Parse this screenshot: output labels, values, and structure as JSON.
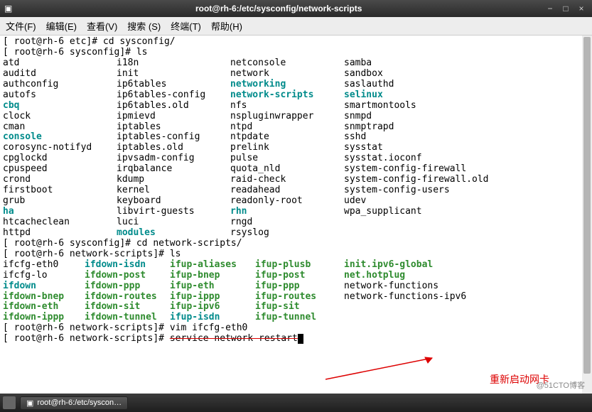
{
  "titlebar": {
    "title": "root@rh-6:/etc/sysconfig/network-scripts"
  },
  "menubar": {
    "items": [
      {
        "label": "文件(F)"
      },
      {
        "label": "编辑(E)"
      },
      {
        "label": "查看(V)"
      },
      {
        "label": "搜索 (S)"
      },
      {
        "label": "终端(T)"
      },
      {
        "label": "帮助(H)"
      }
    ]
  },
  "terminal": {
    "line1_prompt_open": "[ root@rh-6 etc]# ",
    "line1_cmd": "cd sysconfig/",
    "line2_prompt_open": "[ root@rh-6 sysconfig]# ",
    "line2_cmd": "ls",
    "ls1": [
      {
        "c1": {
          "t": "atd"
        },
        "c2": {
          "t": "i18n"
        },
        "c3": {
          "t": "netconsole"
        },
        "c4": {
          "t": "samba"
        }
      },
      {
        "c1": {
          "t": "auditd"
        },
        "c2": {
          "t": "init"
        },
        "c3": {
          "t": "network"
        },
        "c4": {
          "t": "sandbox"
        }
      },
      {
        "c1": {
          "t": "authconfig"
        },
        "c2": {
          "t": "ip6tables"
        },
        "c3": {
          "t": "networking",
          "cls": "cyan"
        },
        "c4": {
          "t": "saslauthd"
        }
      },
      {
        "c1": {
          "t": "autofs"
        },
        "c2": {
          "t": "ip6tables-config"
        },
        "c3": {
          "t": "network-scripts",
          "cls": "cyan"
        },
        "c4": {
          "t": "selinux",
          "cls": "cyan"
        }
      },
      {
        "c1": {
          "t": "cbq",
          "cls": "cyan"
        },
        "c2": {
          "t": "ip6tables.old"
        },
        "c3": {
          "t": "nfs"
        },
        "c4": {
          "t": "smartmontools"
        }
      },
      {
        "c1": {
          "t": "clock"
        },
        "c2": {
          "t": "ipmievd"
        },
        "c3": {
          "t": "nspluginwrapper"
        },
        "c4": {
          "t": "snmpd"
        }
      },
      {
        "c1": {
          "t": "cman"
        },
        "c2": {
          "t": "iptables"
        },
        "c3": {
          "t": "ntpd"
        },
        "c4": {
          "t": "snmptrapd"
        }
      },
      {
        "c1": {
          "t": "console",
          "cls": "cyan"
        },
        "c2": {
          "t": "iptables-config"
        },
        "c3": {
          "t": "ntpdate"
        },
        "c4": {
          "t": "sshd"
        }
      },
      {
        "c1": {
          "t": "corosync-notifyd"
        },
        "c2": {
          "t": "iptables.old"
        },
        "c3": {
          "t": "prelink"
        },
        "c4": {
          "t": "sysstat"
        }
      },
      {
        "c1": {
          "t": "cpglockd"
        },
        "c2": {
          "t": "ipvsadm-config"
        },
        "c3": {
          "t": "pulse"
        },
        "c4": {
          "t": "sysstat.ioconf"
        }
      },
      {
        "c1": {
          "t": "cpuspeed"
        },
        "c2": {
          "t": "irqbalance"
        },
        "c3": {
          "t": "quota_nld"
        },
        "c4": {
          "t": "system-config-firewall"
        }
      },
      {
        "c1": {
          "t": "crond"
        },
        "c2": {
          "t": "kdump"
        },
        "c3": {
          "t": "raid-check"
        },
        "c4": {
          "t": "system-config-firewall.old"
        }
      },
      {
        "c1": {
          "t": "firstboot"
        },
        "c2": {
          "t": "kernel"
        },
        "c3": {
          "t": "readahead"
        },
        "c4": {
          "t": "system-config-users"
        }
      },
      {
        "c1": {
          "t": "grub"
        },
        "c2": {
          "t": "keyboard"
        },
        "c3": {
          "t": "readonly-root"
        },
        "c4": {
          "t": "udev"
        }
      },
      {
        "c1": {
          "t": "ha",
          "cls": "cyan"
        },
        "c2": {
          "t": "libvirt-guests"
        },
        "c3": {
          "t": "rhn",
          "cls": "cyan"
        },
        "c4": {
          "t": "wpa_supplicant"
        }
      },
      {
        "c1": {
          "t": "htcacheclean"
        },
        "c2": {
          "t": "luci"
        },
        "c3": {
          "t": "rngd"
        },
        "c4": {
          "t": ""
        }
      },
      {
        "c1": {
          "t": "httpd"
        },
        "c2": {
          "t": "modules",
          "cls": "cyan"
        },
        "c3": {
          "t": "rsyslog"
        },
        "c4": {
          "t": ""
        }
      }
    ],
    "line3_prompt": "[ root@rh-6 sysconfig]# ",
    "line3_cmd": "cd network-scripts/",
    "line4_prompt": "[ root@rh-6 network-scripts]# ",
    "line4_cmd": "ls",
    "ls2": [
      {
        "c1": {
          "t": "ifcfg-eth0"
        },
        "c2": {
          "t": "ifdown-isdn",
          "cls": "cyan"
        },
        "c3": {
          "t": "ifup-aliases",
          "cls": "green"
        },
        "c4": {
          "t": "ifup-plusb",
          "cls": "green"
        },
        "c5": {
          "t": "init.ipv6-global",
          "cls": "green"
        }
      },
      {
        "c1": {
          "t": "ifcfg-lo"
        },
        "c2": {
          "t": "ifdown-post",
          "cls": "green"
        },
        "c3": {
          "t": "ifup-bnep",
          "cls": "green"
        },
        "c4": {
          "t": "ifup-post",
          "cls": "green"
        },
        "c5": {
          "t": "net.hotplug",
          "cls": "green"
        }
      },
      {
        "c1": {
          "t": "ifdown",
          "cls": "cyan"
        },
        "c2": {
          "t": "ifdown-ppp",
          "cls": "green"
        },
        "c3": {
          "t": "ifup-eth",
          "cls": "green"
        },
        "c4": {
          "t": "ifup-ppp",
          "cls": "green"
        },
        "c5": {
          "t": "network-functions"
        }
      },
      {
        "c1": {
          "t": "ifdown-bnep",
          "cls": "green"
        },
        "c2": {
          "t": "ifdown-routes",
          "cls": "green"
        },
        "c3": {
          "t": "ifup-ippp",
          "cls": "green"
        },
        "c4": {
          "t": "ifup-routes",
          "cls": "green"
        },
        "c5": {
          "t": "network-functions-ipv6"
        }
      },
      {
        "c1": {
          "t": "ifdown-eth",
          "cls": "green"
        },
        "c2": {
          "t": "ifdown-sit",
          "cls": "green"
        },
        "c3": {
          "t": "ifup-ipv6",
          "cls": "green"
        },
        "c4": {
          "t": "ifup-sit",
          "cls": "green"
        },
        "c5": {
          "t": ""
        }
      },
      {
        "c1": {
          "t": "ifdown-ippp",
          "cls": "green"
        },
        "c2": {
          "t": "ifdown-tunnel",
          "cls": "green"
        },
        "c3": {
          "t": "ifup-isdn",
          "cls": "cyan"
        },
        "c4": {
          "t": "ifup-tunnel",
          "cls": "green"
        },
        "c5": {
          "t": ""
        }
      }
    ],
    "line5_prompt": "[ root@rh-6 network-scripts]# ",
    "line5_cmd": "vim ifcfg-eth0",
    "line6_prompt": "[ root@rh-6 network-scripts]# ",
    "line6_cmd": "service network restart"
  },
  "annotation": {
    "text": "重新启动网卡"
  },
  "taskbar": {
    "button_label": "root@rh-6:/etc/syscon…"
  },
  "watermark": "@51CTO博客"
}
